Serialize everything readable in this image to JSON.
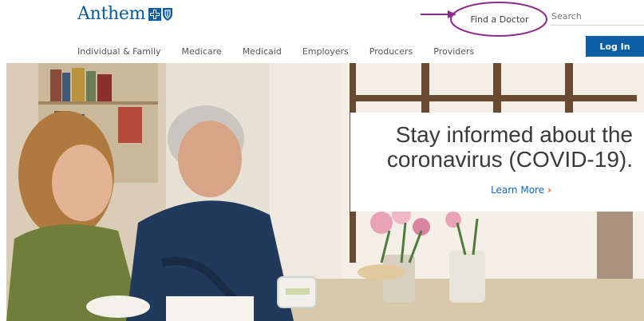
{
  "brand": {
    "name": "Anthem",
    "colors": {
      "primary": "#0b5ea3",
      "accent_link": "#1368c4",
      "chevron": "#e04e39"
    }
  },
  "header": {
    "find_doctor_label": "Find a Doctor",
    "search": {
      "placeholder": "Search",
      "value": ""
    },
    "login_label": "Log In"
  },
  "nav": {
    "items": [
      {
        "label": "Individual & Family"
      },
      {
        "label": "Medicare"
      },
      {
        "label": "Medicaid"
      },
      {
        "label": "Employers"
      },
      {
        "label": "Producers"
      },
      {
        "label": "Providers"
      }
    ]
  },
  "hero": {
    "image": "couple-reviewing-papers-at-kitchen-table",
    "promo": {
      "heading": "Stay informed about the\ncoronavirus (COVID-19).",
      "link_label": "Learn More",
      "link_icon": "chevron-right-icon"
    }
  },
  "annotations": {
    "highlight_color": "#8e2a8e",
    "items": [
      "arrow-pointing-to-find-doctor",
      "ellipse-around-find-doctor"
    ]
  }
}
